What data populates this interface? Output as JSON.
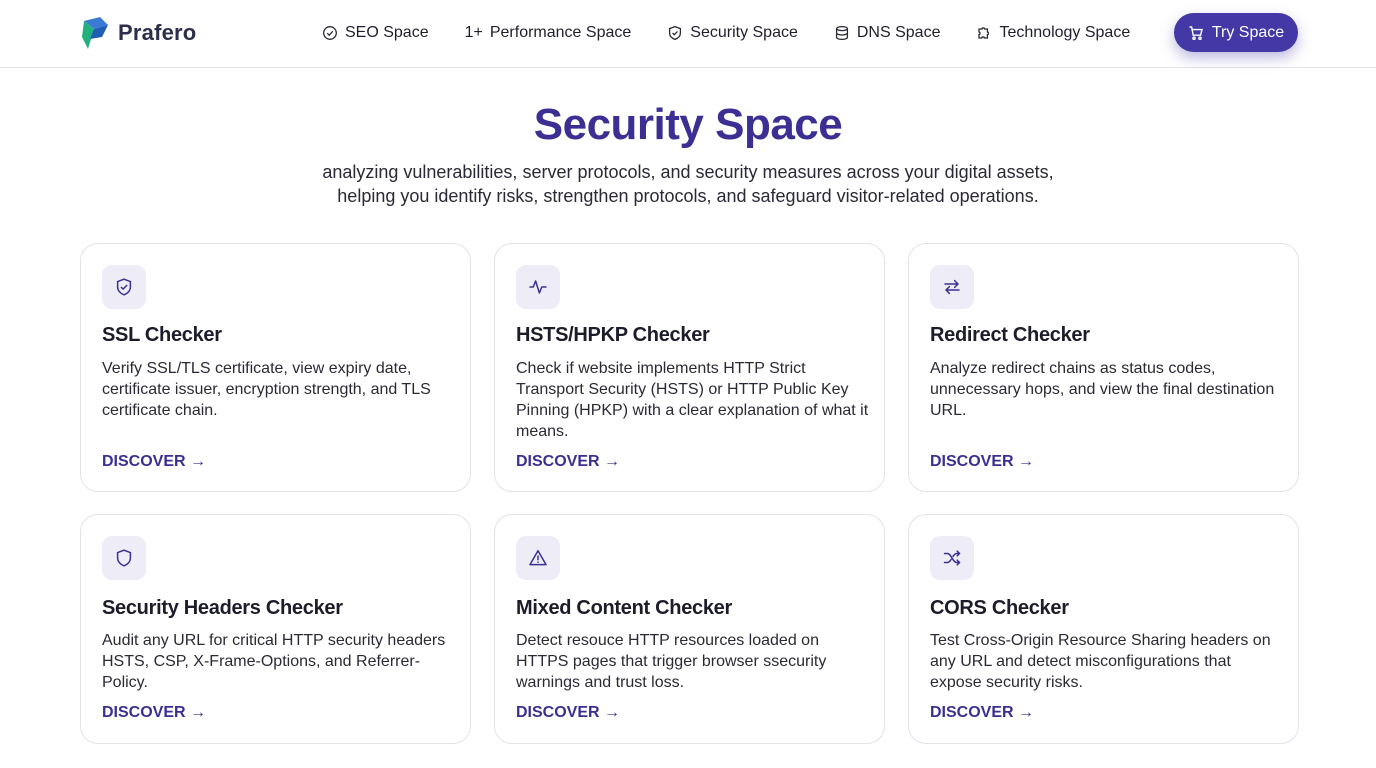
{
  "brand": {
    "name": "Prafero"
  },
  "nav": {
    "items": [
      {
        "label": "SEO Space",
        "icon": "check-circle-icon"
      },
      {
        "prefix": "1+",
        "label": "Performance Space"
      },
      {
        "label": "Security Space",
        "icon": "shield-check-icon"
      },
      {
        "label": "DNS Space",
        "icon": "database-icon"
      },
      {
        "label": "Technology Space",
        "icon": "puzzle-icon"
      }
    ]
  },
  "cta": {
    "label": "Try Space",
    "icon": "cart-icon"
  },
  "hero": {
    "title": "Security Space",
    "subtitle": "analyzing vulnerabilities, server protocols, and security measures across your digital assets, helping you identify risks, strengthen protocols, and safeguard visitor-related operations."
  },
  "cards": [
    {
      "title": "SSL Checker",
      "description": "Verify SSL/TLS certificate, view expiry date, certificate issuer, encryption strength, and TLS certificate chain.",
      "link": "DISCOVER →",
      "icon": "shield-check-icon"
    },
    {
      "title": "HSTS/HPKP Checker",
      "description": "Check if website implements HTTP Strict Transport Security (HSTS) or HTTP Public Key Pinning (HPKP) with a clear explanation of what it means.",
      "link": "DISCOVER →",
      "icon": "activity-icon"
    },
    {
      "title": "Redirect Checker",
      "description": "Analyze redirect chains as status codes, unnecessary hops, and view the final destination URL.",
      "link": "DISCOVER →",
      "icon": "arrows-exchange-icon"
    },
    {
      "title": "Security Headers Checker",
      "description": "Audit any URL for critical HTTP security headers HSTS, CSP, X-Frame-Options, and Referrer-Policy.",
      "link": "DISCOVER →",
      "icon": "shield-icon"
    },
    {
      "title": "Mixed Content Checker",
      "description": "Detect resouce HTTP resources loaded on HTTPS pages that trigger browser ssecurity warnings and trust loss.",
      "link": "DISCOVER →",
      "icon": "warning-triangle-icon"
    },
    {
      "title": "CORS Checker",
      "description": "Test Cross-Origin Resource Sharing headers on any URL and detect misconfigurations that expose security risks.",
      "link": "DISCOVER →",
      "icon": "shuffle-icon"
    }
  ],
  "colors": {
    "accent": "#3b2f93",
    "button": "#4338a6",
    "icon_tile": "#eeedf7",
    "border": "#e3e3ea"
  }
}
